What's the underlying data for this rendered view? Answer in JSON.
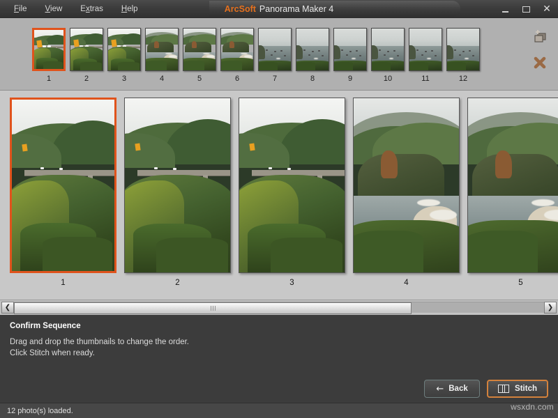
{
  "window": {
    "brand": "ArcSoft",
    "product": "Panorama Maker 4",
    "controls": {
      "minimize": "minimize-window",
      "maximize": "maximize-window",
      "close": "✕"
    }
  },
  "menubar": {
    "items": [
      {
        "label": "File",
        "mnemonic": "F",
        "pre": "",
        "post": "ile"
      },
      {
        "label": "View",
        "mnemonic": "V",
        "pre": "",
        "post": "iew"
      },
      {
        "label": "Extras",
        "mnemonic": "x",
        "pre": "E",
        "post": "tras"
      },
      {
        "label": "Help",
        "mnemonic": "H",
        "pre": "",
        "post": "elp"
      }
    ]
  },
  "thumbstrip": {
    "selected_index": 0,
    "thumbnails": [
      {
        "number": "1",
        "scene": "bridge"
      },
      {
        "number": "2",
        "scene": "bridge"
      },
      {
        "number": "3",
        "scene": "bridge"
      },
      {
        "number": "4",
        "scene": "coast"
      },
      {
        "number": "5",
        "scene": "coast"
      },
      {
        "number": "6",
        "scene": "coast"
      },
      {
        "number": "7",
        "scene": "sea"
      },
      {
        "number": "8",
        "scene": "sea"
      },
      {
        "number": "9",
        "scene": "sea"
      },
      {
        "number": "10",
        "scene": "sea"
      },
      {
        "number": "11",
        "scene": "sea"
      },
      {
        "number": "12",
        "scene": "sea"
      }
    ],
    "tools": [
      {
        "name": "add-photos-icon",
        "title": "Add Photos"
      },
      {
        "name": "remove-photo-icon",
        "title": "Remove Photo"
      }
    ]
  },
  "mainpanel": {
    "selected_index": 0,
    "previews": [
      {
        "number": "1",
        "scene": "bridge"
      },
      {
        "number": "2",
        "scene": "bridge"
      },
      {
        "number": "3",
        "scene": "bridge"
      },
      {
        "number": "4",
        "scene": "coast"
      },
      {
        "number": "5",
        "scene": "coast"
      }
    ]
  },
  "scrollbar": {
    "left_arrow": "❮",
    "right_arrow": "❯",
    "thumb_width_pct": "75"
  },
  "instructions": {
    "title": "Confirm Sequence",
    "line1": "Drag and drop the thumbnails to change the order.",
    "line2": "Click Stitch when ready."
  },
  "actions": {
    "back_label": "Back",
    "back_arrow": "←",
    "stitch_label": "Stitch"
  },
  "watermark": "wsxdn.com",
  "statusbar": {
    "text": "12 photo(s) loaded."
  },
  "colors": {
    "accent_orange": "#e0531c",
    "brand_orange": "#e4701e",
    "stitch_border": "#d4823c",
    "strip_bg": "#b0b0b0",
    "main_bg": "#c8c8c8",
    "panel_dark": "#3c3c3c",
    "status_bg": "#474747"
  }
}
